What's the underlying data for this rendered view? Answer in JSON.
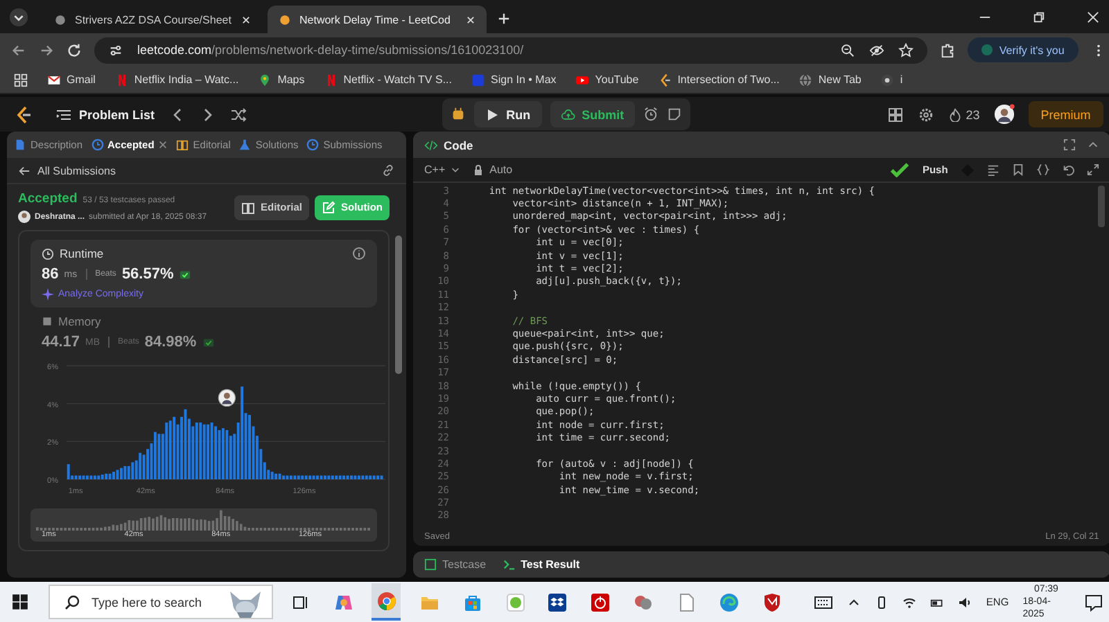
{
  "browser": {
    "tabs": [
      {
        "title": "Strivers A2Z DSA Course/Sheet",
        "selected": false
      },
      {
        "title": "Network Delay Time - LeetCod",
        "selected": true
      }
    ],
    "url_host": "leetcode.com",
    "url_path": "/problems/network-delay-time/submissions/1610023100/",
    "profile_button": "Verify it's you"
  },
  "bookmarks": [
    {
      "label": "Gmail",
      "kind": "mail"
    },
    {
      "label": "Netflix India – Watc...",
      "kind": "netflix"
    },
    {
      "label": "Maps",
      "kind": "maps"
    },
    {
      "label": "Netflix - Watch TV S...",
      "kind": "netflix"
    },
    {
      "label": "Sign In • Max",
      "kind": "max"
    },
    {
      "label": "YouTube",
      "kind": "youtube"
    },
    {
      "label": "Intersection of Two...",
      "kind": "leetcode"
    },
    {
      "label": "New Tab",
      "kind": "globe"
    },
    {
      "label": "i",
      "kind": "site"
    }
  ],
  "navbar": {
    "problem_list": "Problem List",
    "run": "Run",
    "submit": "Submit",
    "streak": "23",
    "premium": "Premium"
  },
  "left_panel": {
    "tabs": [
      {
        "label": "Description",
        "selected": false
      },
      {
        "label": "Accepted",
        "selected": true
      },
      {
        "label": "Editorial",
        "selected": false
      },
      {
        "label": "Solutions",
        "selected": false
      },
      {
        "label": "Submissions",
        "selected": false
      }
    ],
    "back_link": "All Submissions",
    "submission": {
      "status": "Accepted",
      "testcases": "53 / 53 testcases passed",
      "author": "Deshratna ...",
      "submitted": "submitted at Apr 18, 2025 08:37",
      "editorial_button": "Editorial",
      "solution_button": "Solution"
    },
    "runtime": {
      "title": "Runtime",
      "value": "86",
      "unit": "ms",
      "beats_label": "Beats",
      "beats": "56.57%",
      "analyze": "Analyze Complexity"
    },
    "memory": {
      "title": "Memory",
      "value": "44.17",
      "unit": "MB",
      "beats_label": "Beats",
      "beats": "84.98%"
    },
    "chart_data": {
      "type": "bar",
      "x": [
        1,
        3,
        5,
        7,
        9,
        11,
        13,
        15,
        17,
        19,
        21,
        23,
        25,
        27,
        29,
        31,
        33,
        35,
        37,
        39,
        41,
        43,
        45,
        47,
        49,
        51,
        53,
        55,
        57,
        59,
        61,
        63,
        65,
        67,
        69,
        71,
        73,
        75,
        77,
        79,
        81,
        83,
        85,
        87,
        89,
        91,
        93,
        95,
        97,
        99,
        101,
        103,
        105,
        107,
        109,
        111,
        113,
        115,
        117,
        119,
        121,
        123,
        125,
        127,
        129,
        131,
        133,
        135,
        137,
        139,
        141,
        143,
        145,
        147,
        149,
        151,
        153,
        155,
        157,
        159,
        161,
        163,
        165,
        167
      ],
      "series": [
        {
          "color": "#1e78e0",
          "values": [
            0.8,
            0.2,
            0.2,
            0.2,
            0.2,
            0.2,
            0.2,
            0.2,
            0.2,
            0.25,
            0.3,
            0.3,
            0.4,
            0.5,
            0.6,
            0.7,
            0.7,
            0.9,
            1.0,
            1.4,
            1.3,
            1.6,
            1.9,
            2.5,
            2.4,
            2.4,
            3.0,
            3.1,
            3.3,
            2.9,
            3.3,
            3.7,
            3.2,
            2.8,
            3.0,
            3.0,
            2.9,
            2.9,
            3.0,
            2.8,
            2.6,
            2.7,
            2.6,
            2.3,
            2.4,
            3.0,
            4.9,
            3.5,
            3.4,
            2.8,
            2.3,
            1.6,
            0.9,
            0.5,
            0.4,
            0.3,
            0.3,
            0.2,
            0.2,
            0.2,
            0.2,
            0.2,
            0.2,
            0.2,
            0.2,
            0.2,
            0.2,
            0.2,
            0.2,
            0.2,
            0.2,
            0.2,
            0.2,
            0.2,
            0.2,
            0.2,
            0.2,
            0.2,
            0.2,
            0.2,
            0.2,
            0.2,
            0.2,
            0.2
          ]
        }
      ],
      "xlim": [
        0,
        169
      ],
      "ylim": [
        0,
        6
      ],
      "xticks": [
        {
          "value": 1,
          "label": "1ms"
        },
        {
          "value": 42,
          "label": "42ms"
        },
        {
          "value": 84,
          "label": "84ms"
        },
        {
          "value": 126,
          "label": "126ms"
        }
      ],
      "yticks": [
        {
          "value": 0,
          "label": "0%"
        },
        {
          "value": 2,
          "label": "2%"
        },
        {
          "value": 4,
          "label": "4%"
        },
        {
          "value": 6,
          "label": "6%"
        }
      ]
    },
    "range_labels": [
      "1ms",
      "42ms",
      "84ms",
      "126ms"
    ]
  },
  "editor": {
    "title": "Code",
    "language": "C++",
    "mode": "Auto",
    "push": "Push",
    "lines": [
      {
        "num": "3",
        "code": "    int networkDelayTime(vector<vector<int>>& times, int n, int src) {"
      },
      {
        "num": "4",
        "code": "        vector<int> distance(n + 1, INT_MAX);"
      },
      {
        "num": "5",
        "code": "        unordered_map<int, vector<pair<int, int>>> adj;"
      },
      {
        "num": "6",
        "code": "        for (vector<int>& vec : times) {"
      },
      {
        "num": "7",
        "code": "            int u = vec[0];"
      },
      {
        "num": "8",
        "code": "            int v = vec[1];"
      },
      {
        "num": "9",
        "code": "            int t = vec[2];"
      },
      {
        "num": "10",
        "code": "            adj[u].push_back({v, t});"
      },
      {
        "num": "11",
        "code": "        }"
      },
      {
        "num": "12"
      },
      {
        "num": "13",
        "code": "        // BFS",
        "kind": "comment"
      },
      {
        "num": "14",
        "code": "        queue<pair<int, int>> que;"
      },
      {
        "num": "15",
        "code": "        que.push({src, 0});"
      },
      {
        "num": "16",
        "code": "        distance[src] = 0;"
      },
      {
        "num": "17"
      },
      {
        "num": "18",
        "code": "        while (!que.empty()) {"
      },
      {
        "num": "19",
        "code": "            auto curr = que.front();"
      },
      {
        "num": "20",
        "code": "            que.pop();"
      },
      {
        "num": "21",
        "code": "            int node = curr.first;"
      },
      {
        "num": "22",
        "code": "            int time = curr.second;"
      },
      {
        "num": "23"
      },
      {
        "num": "24",
        "code": "            for (auto& v : adj[node]) {"
      },
      {
        "num": "25",
        "code": "                int new_node = v.first;"
      },
      {
        "num": "26",
        "code": "                int new_time = v.second;"
      },
      {
        "num": "27"
      },
      {
        "num": "28"
      }
    ],
    "status": "Saved",
    "cursor": "Ln 29, Col 21",
    "bottom_tabs": [
      {
        "label": "Testcase",
        "selected": false
      },
      {
        "label": "Test Result",
        "selected": true
      }
    ]
  },
  "taskbar": {
    "search_placeholder": "Type here to search",
    "apps": [
      {
        "kind": "taskview",
        "selected": false
      },
      {
        "kind": "copilot",
        "selected": false
      },
      {
        "kind": "chrome",
        "selected": true
      },
      {
        "kind": "folder",
        "selected": false
      },
      {
        "kind": "store",
        "selected": false
      },
      {
        "kind": "greenapp",
        "selected": false
      },
      {
        "kind": "dropbox",
        "selected": false
      },
      {
        "kind": "power",
        "selected": false
      },
      {
        "kind": "app",
        "selected": false
      },
      {
        "kind": "file",
        "selected": false
      },
      {
        "kind": "edge",
        "selected": false
      },
      {
        "kind": "shield",
        "selected": false
      }
    ],
    "language": "ENG",
    "time": "07:39",
    "date": "18-04-2025"
  }
}
